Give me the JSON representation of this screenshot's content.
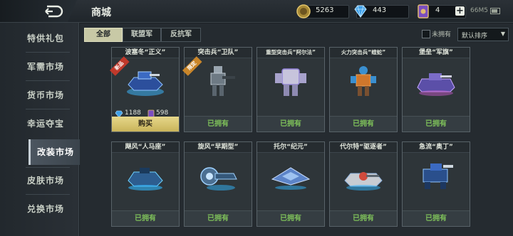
{
  "topbar": {
    "title": "商城",
    "gold": "5263",
    "gems": "443",
    "cards": "4",
    "add": "+",
    "memory": "66M5",
    "icons": [
      "back-icon",
      "gold-coin-icon",
      "diamond-icon",
      "card-icon",
      "plus-icon",
      "battery-icon"
    ]
  },
  "sidebar": {
    "items": [
      {
        "label": "特供礼包"
      },
      {
        "label": "军需市场"
      },
      {
        "label": "货币市场"
      },
      {
        "label": "幸运夺宝"
      },
      {
        "label": "改装市场"
      },
      {
        "label": "皮肤市场"
      },
      {
        "label": "兑换市场"
      }
    ],
    "active_index": 4
  },
  "filters": {
    "tabs": [
      "全部",
      "联盟军",
      "反抗军"
    ],
    "active_tab": 0,
    "owned_only_label": "未拥有",
    "owned_only_checked": false,
    "sort_value": "默认排序"
  },
  "colors": {
    "accent_tab": "#c8c9a6",
    "owned_text": "#7ec05a",
    "buy_button": "#d8c672",
    "ribbon_new": "#c0392b",
    "ribbon_limited": "#c9862a"
  },
  "products": [
    {
      "title": "波塞冬“正义”",
      "ribbon": "新品",
      "gem_price": "1188",
      "card_price": "598",
      "action": "购买",
      "owned": false,
      "art": "hovertank-blue"
    },
    {
      "title": "突击兵“卫队”",
      "ribbon": "限定",
      "status": "已拥有",
      "owned": true,
      "art": "soldier-mech"
    },
    {
      "title": "重型突击兵“阿尔法”",
      "status": "已拥有",
      "owned": true,
      "art": "heavy-mech"
    },
    {
      "title": "火力突击兵“蝰蛇”",
      "status": "已拥有",
      "owned": true,
      "art": "assault-mech"
    },
    {
      "title": "堡垒“军旗”",
      "status": "已拥有",
      "owned": true,
      "art": "fortress-tank"
    },
    {
      "title": "飓风“人马座”",
      "status": "已拥有",
      "owned": true,
      "art": "hover-buggy"
    },
    {
      "title": "旋风“早期型”",
      "status": "已拥有",
      "owned": true,
      "art": "turbine-hover"
    },
    {
      "title": "托尔“纪元”",
      "status": "已拥有",
      "owned": true,
      "art": "jet-craft"
    },
    {
      "title": "代尔特“驱逐者”",
      "status": "已拥有",
      "owned": true,
      "art": "racer-tank"
    },
    {
      "title": "急流“奥丁”",
      "status": "已拥有",
      "owned": true,
      "art": "heavy-walker"
    }
  ]
}
